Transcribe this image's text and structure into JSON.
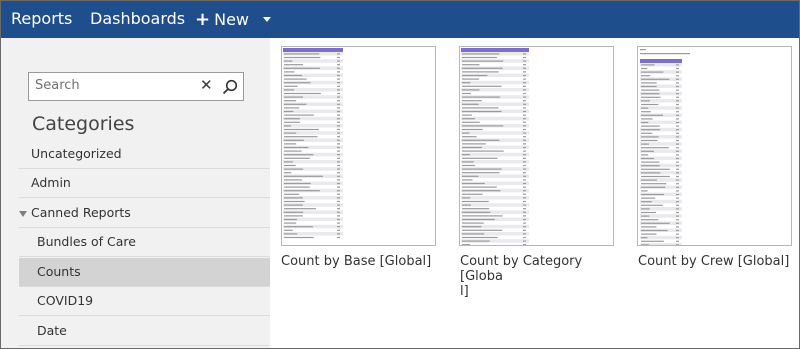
{
  "topbar": {
    "reports": "Reports",
    "dashboards": "Dashboards",
    "new_plus": "+",
    "new_label": "New"
  },
  "search": {
    "placeholder": "Search"
  },
  "categories": {
    "title": "Categories",
    "items": [
      {
        "label": "Uncategorized"
      },
      {
        "label": "Admin"
      },
      {
        "label": "Canned Reports"
      },
      {
        "label": "Bundles of Care"
      },
      {
        "label": "Counts",
        "selected": true
      },
      {
        "label": "COVID19"
      },
      {
        "label": "Date"
      }
    ]
  },
  "reports": [
    {
      "title": "Count by Base [Global]"
    },
    {
      "title_line1": "Count by Category [Globa",
      "title_line2": "l]"
    },
    {
      "title": "Count by Crew [Global]"
    }
  ]
}
